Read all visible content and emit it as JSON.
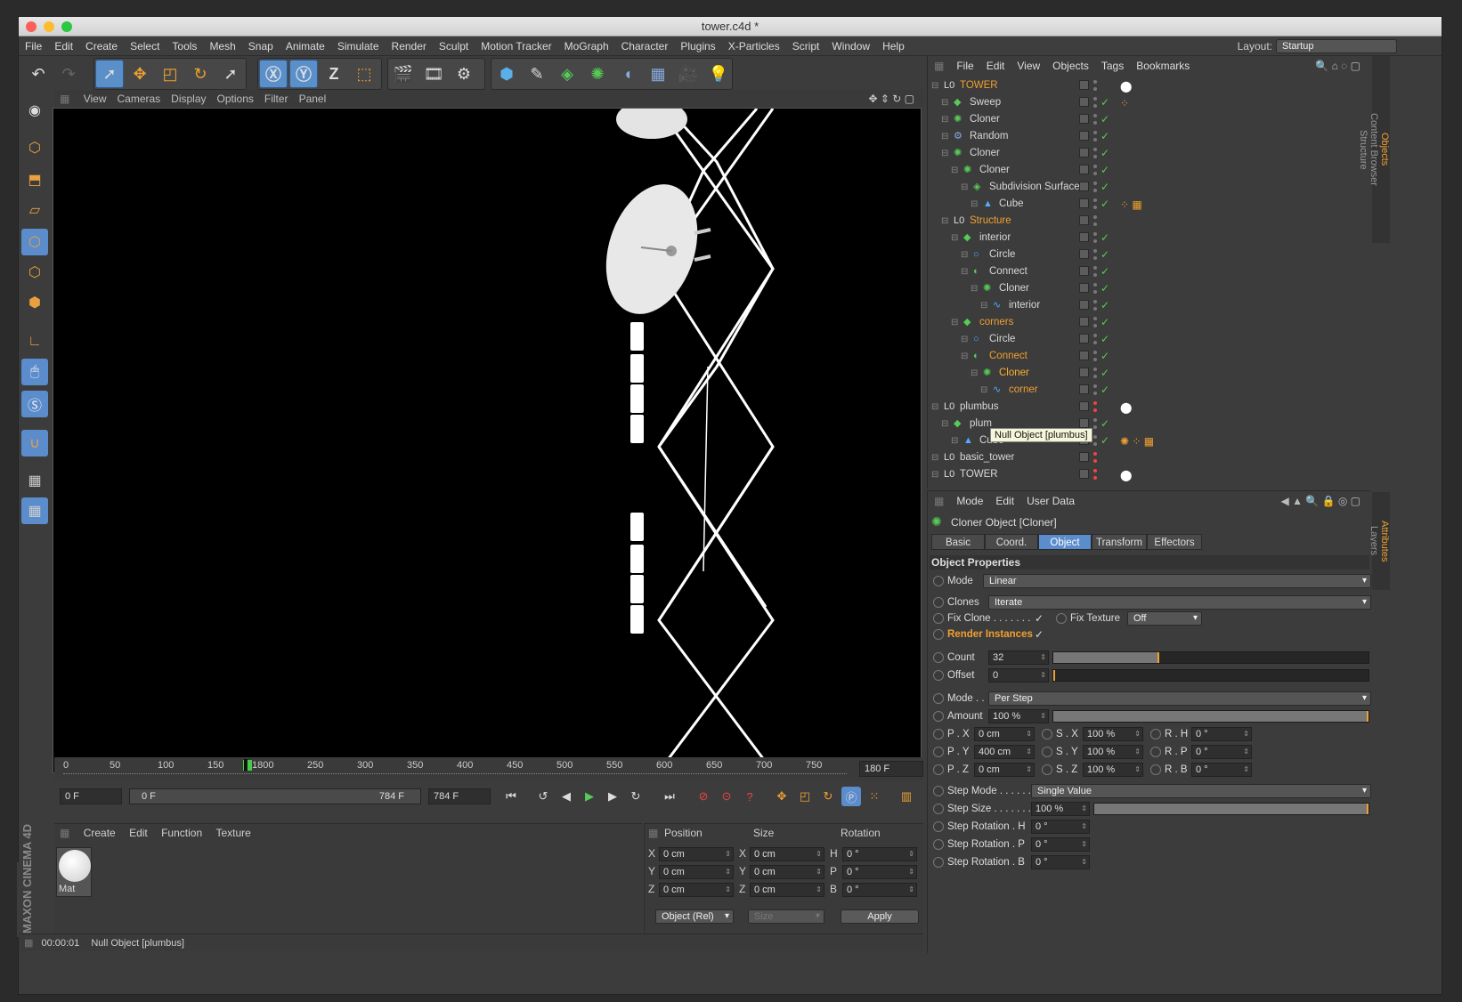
{
  "window": {
    "title": "tower.c4d *"
  },
  "menu": [
    "File",
    "Edit",
    "Create",
    "Select",
    "Tools",
    "Mesh",
    "Snap",
    "Animate",
    "Simulate",
    "Render",
    "Sculpt",
    "Motion Tracker",
    "MoGraph",
    "Character",
    "Plugins",
    "X-Particles",
    "Script",
    "Window",
    "Help"
  ],
  "layout": {
    "label": "Layout:",
    "value": "Startup"
  },
  "viewport_menu": [
    "View",
    "Cameras",
    "Display",
    "Options",
    "Filter",
    "Panel"
  ],
  "timeline": {
    "ticks": [
      "0",
      "50",
      "100",
      "150",
      "200",
      "250",
      "300",
      "350",
      "400",
      "450",
      "500",
      "550",
      "600",
      "650",
      "700",
      "750"
    ],
    "current_marker": "1800",
    "end_field": "180 F"
  },
  "playback": {
    "start": "0 F",
    "range_start": "0 F",
    "range_end": "784 F",
    "end": "784 F"
  },
  "material_panel": {
    "menu": [
      "Create",
      "Edit",
      "Function",
      "Texture"
    ],
    "material_name": "Mat"
  },
  "coord_panel": {
    "headers": [
      "Position",
      "Size",
      "Rotation"
    ],
    "rows": [
      {
        "a": "X",
        "pos": "0 cm",
        "b": "X",
        "size": "0 cm",
        "c": "H",
        "rot": "0 °"
      },
      {
        "a": "Y",
        "pos": "0 cm",
        "b": "Y",
        "size": "0 cm",
        "c": "P",
        "rot": "0 °"
      },
      {
        "a": "Z",
        "pos": "0 cm",
        "b": "Z",
        "size": "0 cm",
        "c": "B",
        "rot": "0 °"
      }
    ],
    "mode": "Object (Rel)",
    "size_mode": "Size",
    "apply": "Apply"
  },
  "status": {
    "time": "00:00:01",
    "message": "Null Object [plumbus]"
  },
  "brand": "MAXON CINEMA 4D",
  "objects_panel": {
    "menu": [
      "File",
      "Edit",
      "View",
      "Objects",
      "Tags",
      "Bookmarks"
    ],
    "rows": [
      {
        "name": "TOWER",
        "level": 0,
        "color": "#f0a030",
        "icon": "null-icon",
        "tag": "white"
      },
      {
        "name": "Sweep",
        "level": 1,
        "color": "#d8d8d8",
        "icon": "sweep-icon",
        "tag": "orange"
      },
      {
        "name": "Cloner",
        "level": 1,
        "color": "#d8d8d8",
        "icon": "cloner-icon",
        "tag": ""
      },
      {
        "name": "Random",
        "level": 1,
        "color": "#d8d8d8",
        "icon": "random-icon",
        "tag": ""
      },
      {
        "name": "Cloner",
        "level": 1,
        "color": "#d8d8d8",
        "icon": "cloner-icon",
        "tag": ""
      },
      {
        "name": "Cloner",
        "level": 2,
        "color": "#d8d8d8",
        "icon": "cloner-icon",
        "tag": ""
      },
      {
        "name": "Subdivision Surface",
        "level": 3,
        "color": "#d8d8d8",
        "icon": "subdivision-icon",
        "tag": ""
      },
      {
        "name": "Cube",
        "level": 4,
        "color": "#d8d8d8",
        "icon": "cube-icon",
        "tag": "checker"
      },
      {
        "name": "Structure",
        "level": 1,
        "color": "#f0a030",
        "icon": "null-icon",
        "tag": ""
      },
      {
        "name": "interior",
        "level": 2,
        "color": "#d8d8d8",
        "icon": "sweep-icon",
        "tag": ""
      },
      {
        "name": "Circle",
        "level": 3,
        "color": "#d8d8d8",
        "icon": "circle-icon",
        "tag": ""
      },
      {
        "name": "Connect",
        "level": 3,
        "color": "#d8d8d8",
        "icon": "connect-icon",
        "tag": ""
      },
      {
        "name": "Cloner",
        "level": 4,
        "color": "#d8d8d8",
        "icon": "cloner-icon",
        "tag": ""
      },
      {
        "name": "interior",
        "level": 5,
        "color": "#d8d8d8",
        "icon": "spline-icon",
        "tag": ""
      },
      {
        "name": "corners",
        "level": 2,
        "color": "#f0a030",
        "icon": "sweep-icon",
        "tag": ""
      },
      {
        "name": "Circle",
        "level": 3,
        "color": "#d8d8d8",
        "icon": "circle-icon",
        "tag": ""
      },
      {
        "name": "Connect",
        "level": 3,
        "color": "#f0a030",
        "icon": "connect-icon",
        "tag": ""
      },
      {
        "name": "Cloner",
        "level": 4,
        "color": "#ffb030",
        "icon": "cloner-icon",
        "tag": ""
      },
      {
        "name": "corner",
        "level": 5,
        "color": "#f0a030",
        "icon": "spline-icon",
        "tag": ""
      },
      {
        "name": "plumbus",
        "level": 0,
        "color": "#d8d8d8",
        "icon": "null-icon",
        "tag": "white"
      },
      {
        "name": "plum",
        "level": 1,
        "color": "#d8d8d8",
        "icon": "sweep-icon",
        "tag": ""
      },
      {
        "name": "Cube",
        "level": 2,
        "color": "#d8d8d8",
        "icon": "cube-icon",
        "tag": "multi"
      },
      {
        "name": "basic_tower",
        "level": 0,
        "color": "#d8d8d8",
        "icon": "null-icon",
        "tag": ""
      },
      {
        "name": "TOWER",
        "level": 0,
        "color": "#d8d8d8",
        "icon": "null-icon",
        "tag": "white"
      }
    ],
    "tooltip": "Null Object [plumbus]"
  },
  "side_tabs_top": [
    "Objects",
    "Content Browser",
    "Structure"
  ],
  "side_tabs_bottom": [
    "Attributes",
    "Layers"
  ],
  "attributes": {
    "menu": [
      "Mode",
      "Edit",
      "User Data"
    ],
    "object_title": "Cloner Object [Cloner]",
    "tabs": [
      "Basic",
      "Coord.",
      "Object",
      "Transform",
      "Effectors"
    ],
    "selected_tab": "Object",
    "section": "Object Properties",
    "mode_label": "Mode",
    "mode_value": "Linear",
    "clones_label": "Clones",
    "clones_value": "Iterate",
    "fix_clone_label": "Fix Clone . . . . . . .",
    "fix_texture_label": "Fix Texture",
    "fix_texture_value": "Off",
    "render_instances_label": "Render Instances",
    "count_label": "Count",
    "count_value": "32",
    "count_slider": 0.33,
    "offset_label": "Offset",
    "offset_value": "0",
    "mode2_label": "Mode . .",
    "mode2_value": "Per Step",
    "amount_label": "Amount",
    "amount_value": "100 %",
    "pxyz": [
      {
        "p": "P . X",
        "pv": "0 cm",
        "s": "S . X",
        "sv": "100 %",
        "r": "R . H",
        "rv": "0 °"
      },
      {
        "p": "P . Y",
        "pv": "400 cm",
        "s": "S . Y",
        "sv": "100 %",
        "r": "R . P",
        "rv": "0 °"
      },
      {
        "p": "P . Z",
        "pv": "0 cm",
        "s": "S . Z",
        "sv": "100 %",
        "r": "R . B",
        "rv": "0 °"
      }
    ],
    "step_mode_label": "Step Mode . . . . . .",
    "step_mode_value": "Single Value",
    "step_size_label": "Step Size . . . . . . .",
    "step_size_value": "100 %",
    "step_rot": [
      {
        "label": "Step Rotation . H",
        "value": "0 °"
      },
      {
        "label": "Step Rotation . P",
        "value": "0 °"
      },
      {
        "label": "Step Rotation . B",
        "value": "0 °"
      }
    ]
  }
}
